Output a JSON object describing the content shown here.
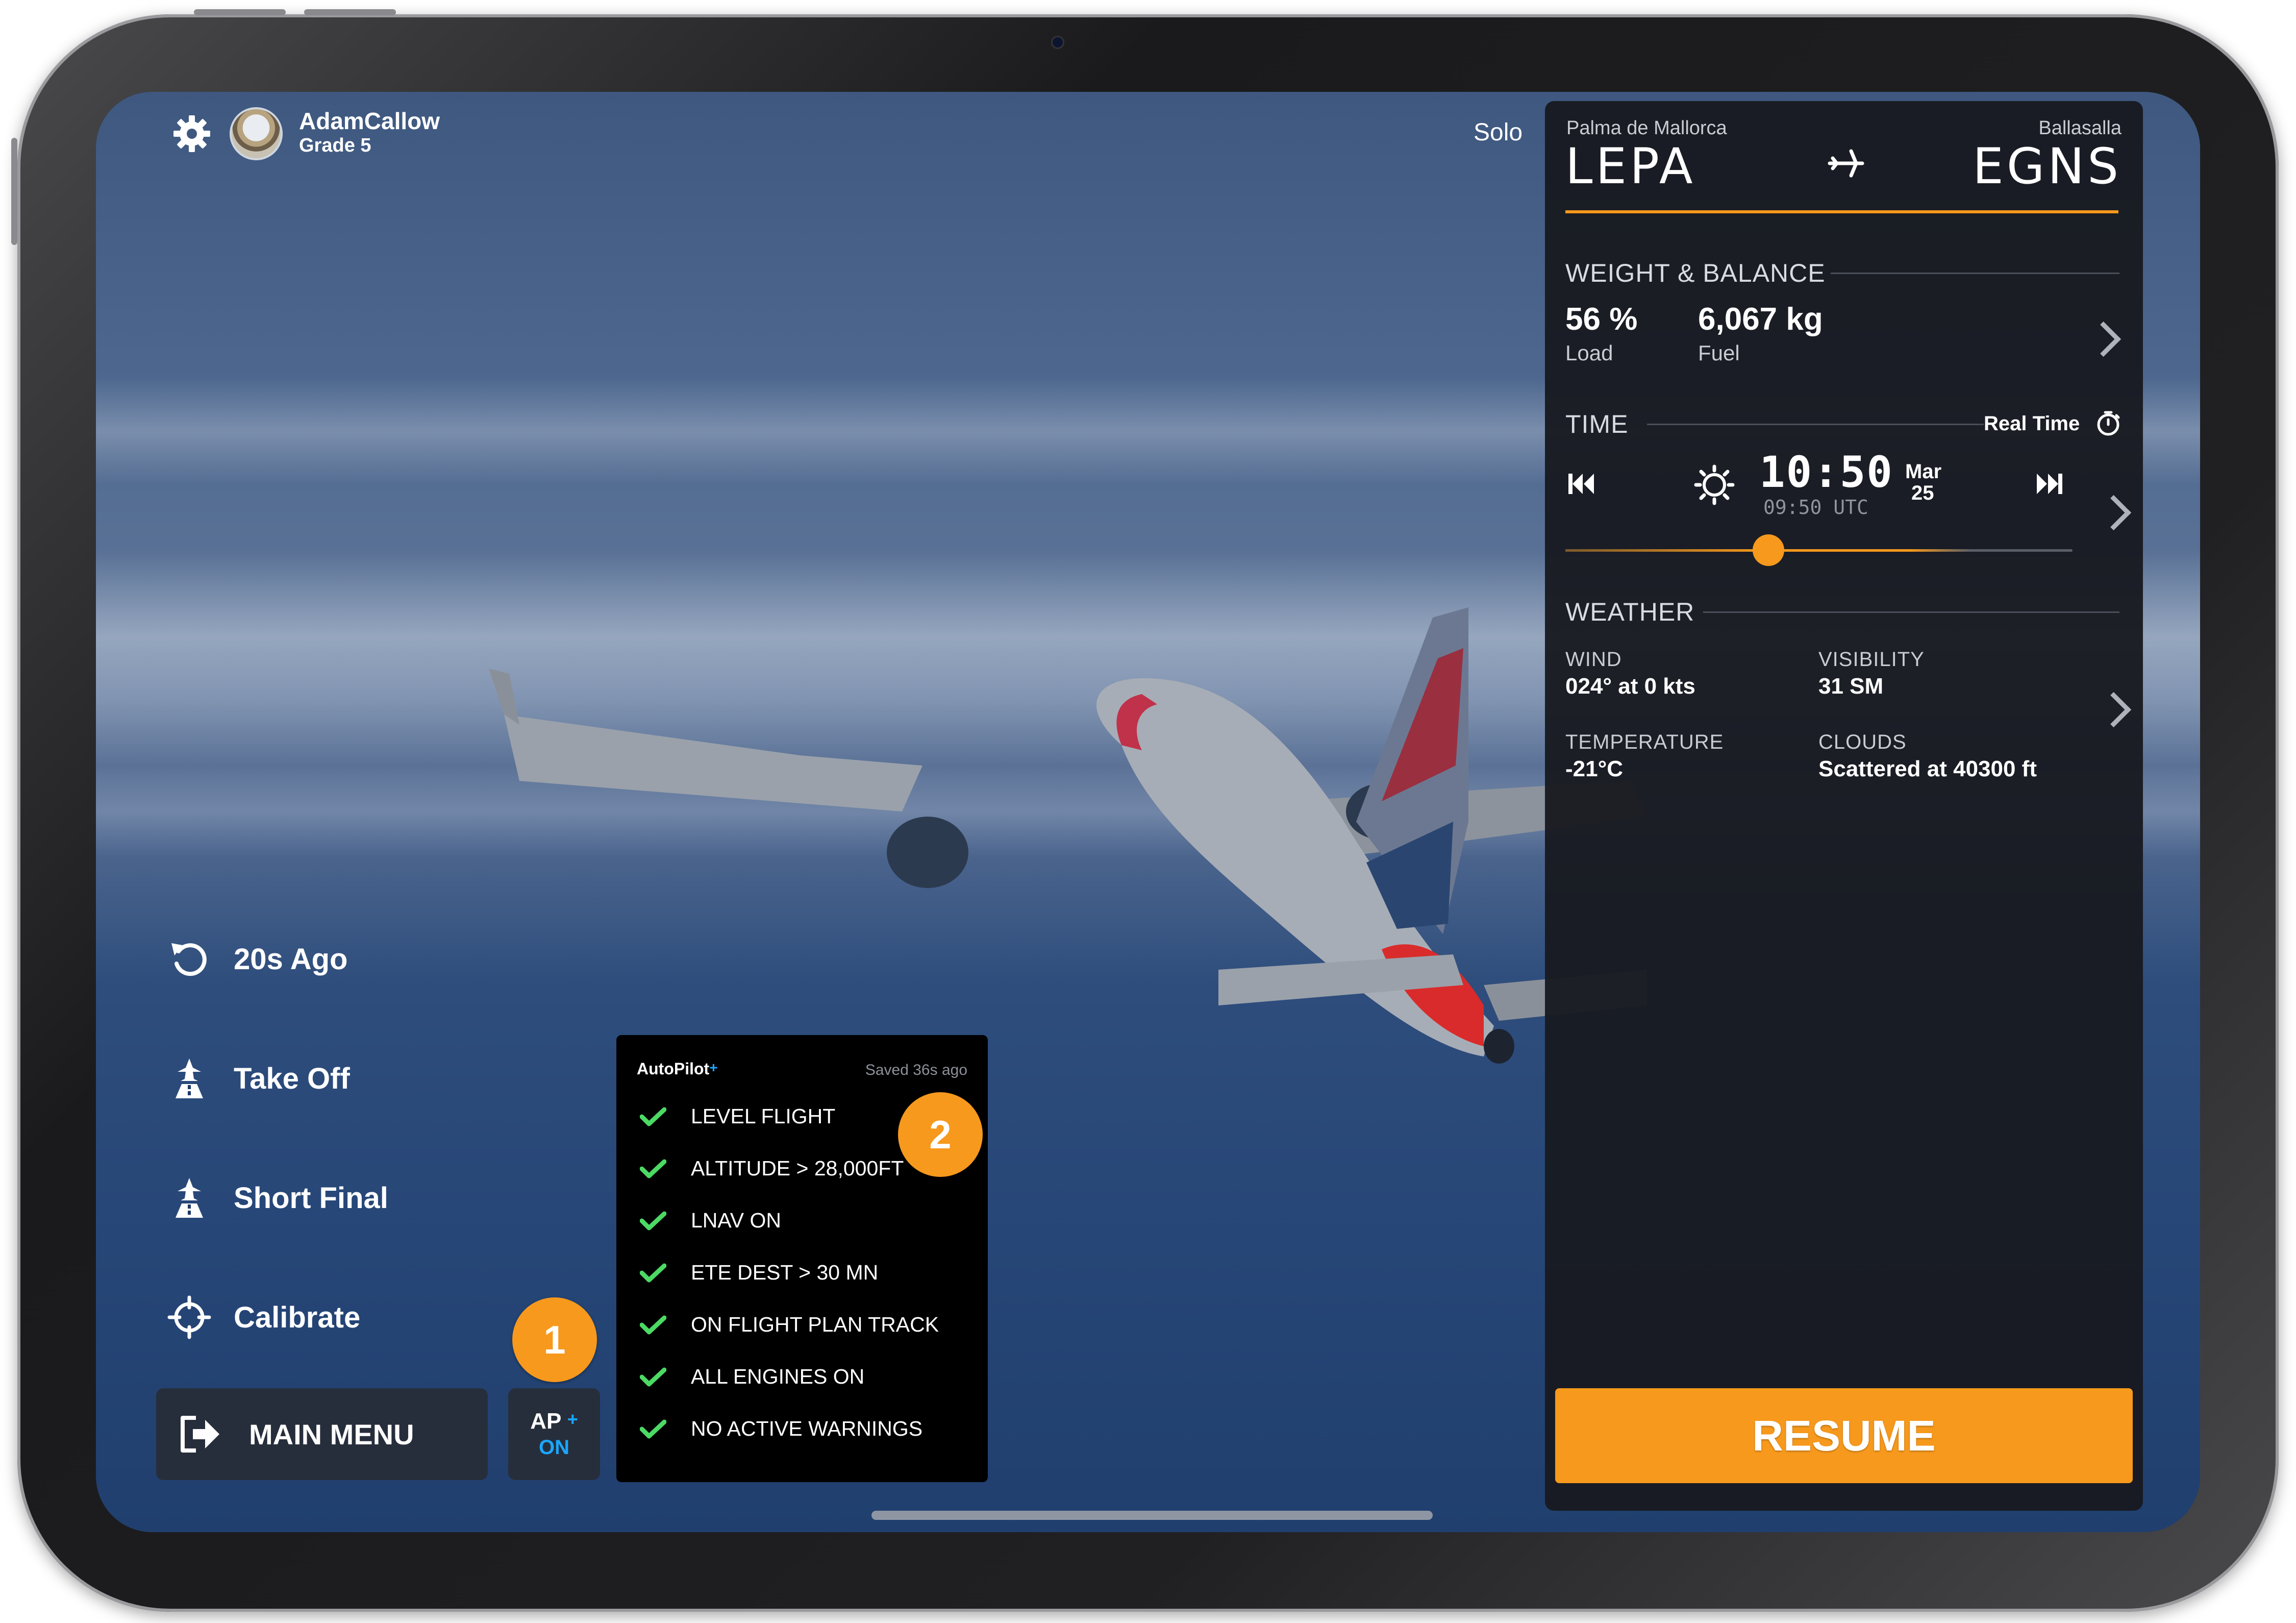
{
  "user": {
    "name": "AdamCallow",
    "grade": "Grade 5"
  },
  "mode": "Solo",
  "route": {
    "origin_city": "Palma de Mallorca",
    "origin_code": "LEPA",
    "dest_city": "Ballasalla",
    "dest_code": "EGNS"
  },
  "weight_balance": {
    "header": "WEIGHT & BALANCE",
    "load_value": "56 %",
    "load_label": "Load",
    "fuel_value": "6,067 kg",
    "fuel_label": "Fuel"
  },
  "time": {
    "header": "TIME",
    "mode_label": "Real Time",
    "local": "10:50",
    "utc": "09:50 UTC",
    "month": "Mar",
    "day": "25",
    "slider_fraction": 0.4
  },
  "weather": {
    "header": "WEATHER",
    "wind_label": "WIND",
    "wind_value": "024° at 0 kts",
    "visibility_label": "VISIBILITY",
    "visibility_value": "31 SM",
    "temperature_label": "TEMPERATURE",
    "temperature_value": "-21°C",
    "clouds_label": "CLOUDS",
    "clouds_value": "Scattered at 40300 ft"
  },
  "resume_label": "RESUME",
  "left_menu": {
    "rewind": "20s Ago",
    "takeoff": "Take Off",
    "short_final": "Short Final",
    "calibrate": "Calibrate",
    "main_menu": "MAIN MENU"
  },
  "ap_button": {
    "label": "AP",
    "plus": "+",
    "state": "ON"
  },
  "autopilot": {
    "title": "AutoPilot",
    "plus": "+",
    "saved": "Saved 36s ago",
    "checks": [
      "LEVEL FLIGHT",
      "ALTITUDE > 28,000FT",
      "LNAV ON",
      "ETE DEST > 30 MN",
      "ON FLIGHT PLAN TRACK",
      "ALL ENGINES ON",
      "NO ACTIVE WARNINGS"
    ]
  },
  "badges": {
    "one": "1",
    "two": "2"
  },
  "colors": {
    "accent": "#f7991c",
    "check": "#4cd964",
    "ap_blue": "#1aa7ff"
  },
  "icons": [
    "gear-icon",
    "plane-icon",
    "chevron-right-icon",
    "sun-icon",
    "skip-back-icon",
    "skip-forward-icon",
    "timer-icon",
    "rewind-icon",
    "takeoff-icon",
    "landing-icon",
    "crosshair-icon",
    "exit-icon",
    "check-icon"
  ]
}
